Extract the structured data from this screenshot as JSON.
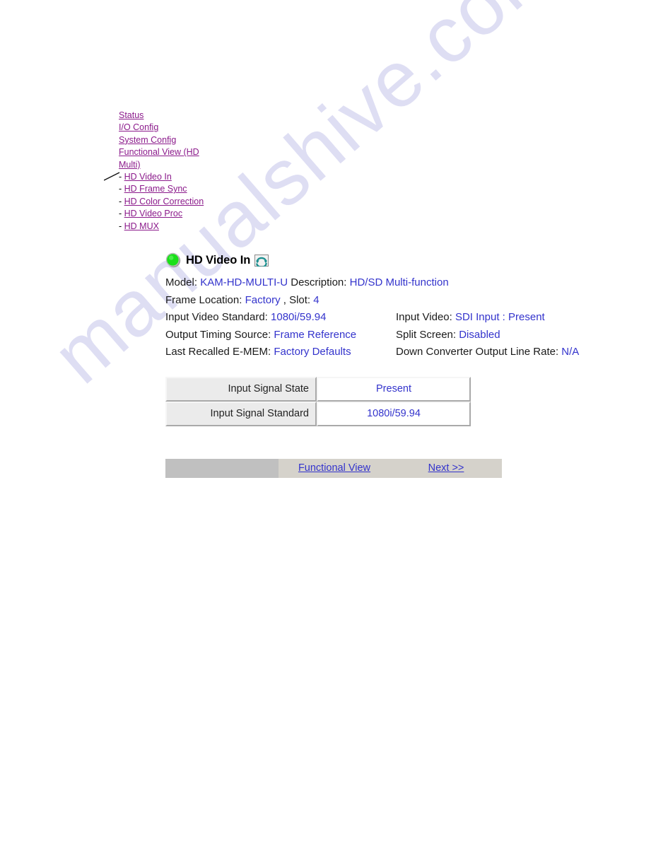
{
  "watermark": {
    "text": "manualshive.com"
  },
  "sidebar": {
    "items": [
      {
        "label": "Status",
        "sub": false
      },
      {
        "label": "I/O Config",
        "sub": false
      },
      {
        "label": "System Config",
        "sub": false
      },
      {
        "label": "Functional View (HD Multi)",
        "sub": false
      },
      {
        "label": "HD Video In",
        "sub": true
      },
      {
        "label": "HD Frame Sync",
        "sub": true
      },
      {
        "label": "HD Color Correction",
        "sub": true
      },
      {
        "label": "HD Video Proc",
        "sub": true
      },
      {
        "label": "HD MUX",
        "sub": true
      }
    ],
    "dash": "-",
    "link_color": "#8b1a8b"
  },
  "panel": {
    "title": "HD Video In",
    "status_led": "green-status-led",
    "refresh": "refresh-icon",
    "led_color": "#22dd22",
    "accent_color": "#3333cc",
    "info": {
      "model_label": "Model:",
      "model_value": "KAM-HD-MULTI-U",
      "description_label": "Description:",
      "description_value": "HD/SD Multi-function",
      "frame_location_label": "Frame Location:",
      "frame_location_value": "Factory",
      "slot_label": ", Slot:",
      "slot_value": "4",
      "input_video_standard_label": "Input Video Standard:",
      "input_video_standard_value": "1080i/59.94",
      "output_timing_source_label": "Output Timing Source:",
      "output_timing_source_value": "Frame Reference",
      "last_recalled_emem_label": "Last Recalled E-MEM:",
      "last_recalled_emem_value": "Factory Defaults",
      "input_video_label": "Input Video:",
      "input_video_value": "SDI Input : Present",
      "split_screen_label": "Split Screen:",
      "split_screen_value": "Disabled",
      "down_converter_label": "Down Converter Output Line Rate:",
      "down_converter_value": "N/A"
    },
    "status_table": {
      "rows": [
        {
          "label": "Input Signal State",
          "value": "Present"
        },
        {
          "label": "Input Signal Standard",
          "value": "1080i/59.94"
        }
      ]
    },
    "navbar": {
      "blank": "",
      "functional_view": "Functional View",
      "next": "Next >>"
    }
  }
}
